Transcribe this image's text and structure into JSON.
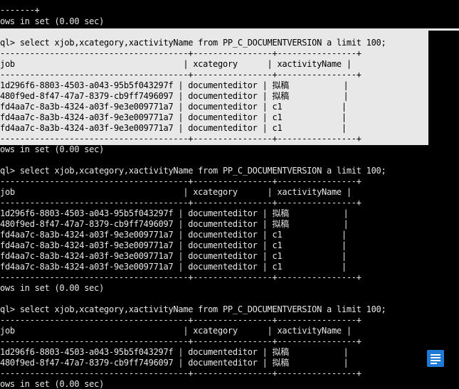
{
  "colors": {
    "background": "#000000",
    "text": "#e6e6e6",
    "selection": "#e8e8e8",
    "selected_text": "#000000",
    "icon": "#1e7ad6"
  },
  "terminal": {
    "lines": [
      "-------+",
      "ows in set (0.00 sec)",
      "",
      "ql> select xjob,xcategory,xactivityName from PP_C_DOCUMENTVERSION a limit 100;",
      "--------------------------------------+----------------+----------------+",
      "job                                  | xcategory      | xactivityName |",
      "--------------------------------------+----------------+----------------+",
      "1d296f6-8803-4503-a043-95b5f043297f | documenteditor | 拟稿           |",
      "480f9ed-8f47-47a7-8379-cb9ff7496097 | documenteditor | 拟稿           |",
      "fd4aa7c-8a3b-4324-a03f-9e3e009771a7 | documenteditor | c1            |",
      "fd4aa7c-8a3b-4324-a03f-9e3e009771a7 | documenteditor | c1            |",
      "fd4aa7c-8a3b-4324-a03f-9e3e009771a7 | documenteditor | c1            |",
      "--------------------------------------+----------------+----------------+",
      "ows in set (0.00 sec)",
      "",
      "ql> select xjob,xcategory,xactivityName from PP_C_DOCUMENTVERSION a limit 100;",
      "--------------------------------------+----------------+----------------+",
      "job                                  | xcategory      | xactivityName |",
      "--------------------------------------+----------------+----------------+",
      "1d296f6-8803-4503-a043-95b5f043297f | documenteditor | 拟稿           |",
      "480f9ed-8f47-47a7-8379-cb9ff7496097 | documenteditor | 拟稿           |",
      "fd4aa7c-8a3b-4324-a03f-9e3e009771a7 | documenteditor | c1            |",
      "fd4aa7c-8a3b-4324-a03f-9e3e009771a7 | documenteditor | c1            |",
      "fd4aa7c-8a3b-4324-a03f-9e3e009771a7 | documenteditor | c1            |",
      "fd4aa7c-8a3b-4324-a03f-9e3e009771a7 | documenteditor | c1            |",
      "--------------------------------------+----------------+----------------+",
      "ows in set (0.00 sec)",
      "",
      "ql> select xjob,xcategory,xactivityName from PP_C_DOCUMENTVERSION a limit 100;",
      "--------------------------------------+----------------+----------------+",
      "job                                  | xcategory      | xactivityName |",
      "--------------------------------------+----------------+----------------+",
      "1d296f6-8803-4503-a043-95b5f043297f | documenteditor | 拟稿           |",
      "480f9ed-8f47-47a7-8379-cb9ff7496097 | documenteditor | 拟稿           |",
      "--------------------------------------+----------------+----------------+",
      "ows in set (0.00 sec)"
    ]
  }
}
